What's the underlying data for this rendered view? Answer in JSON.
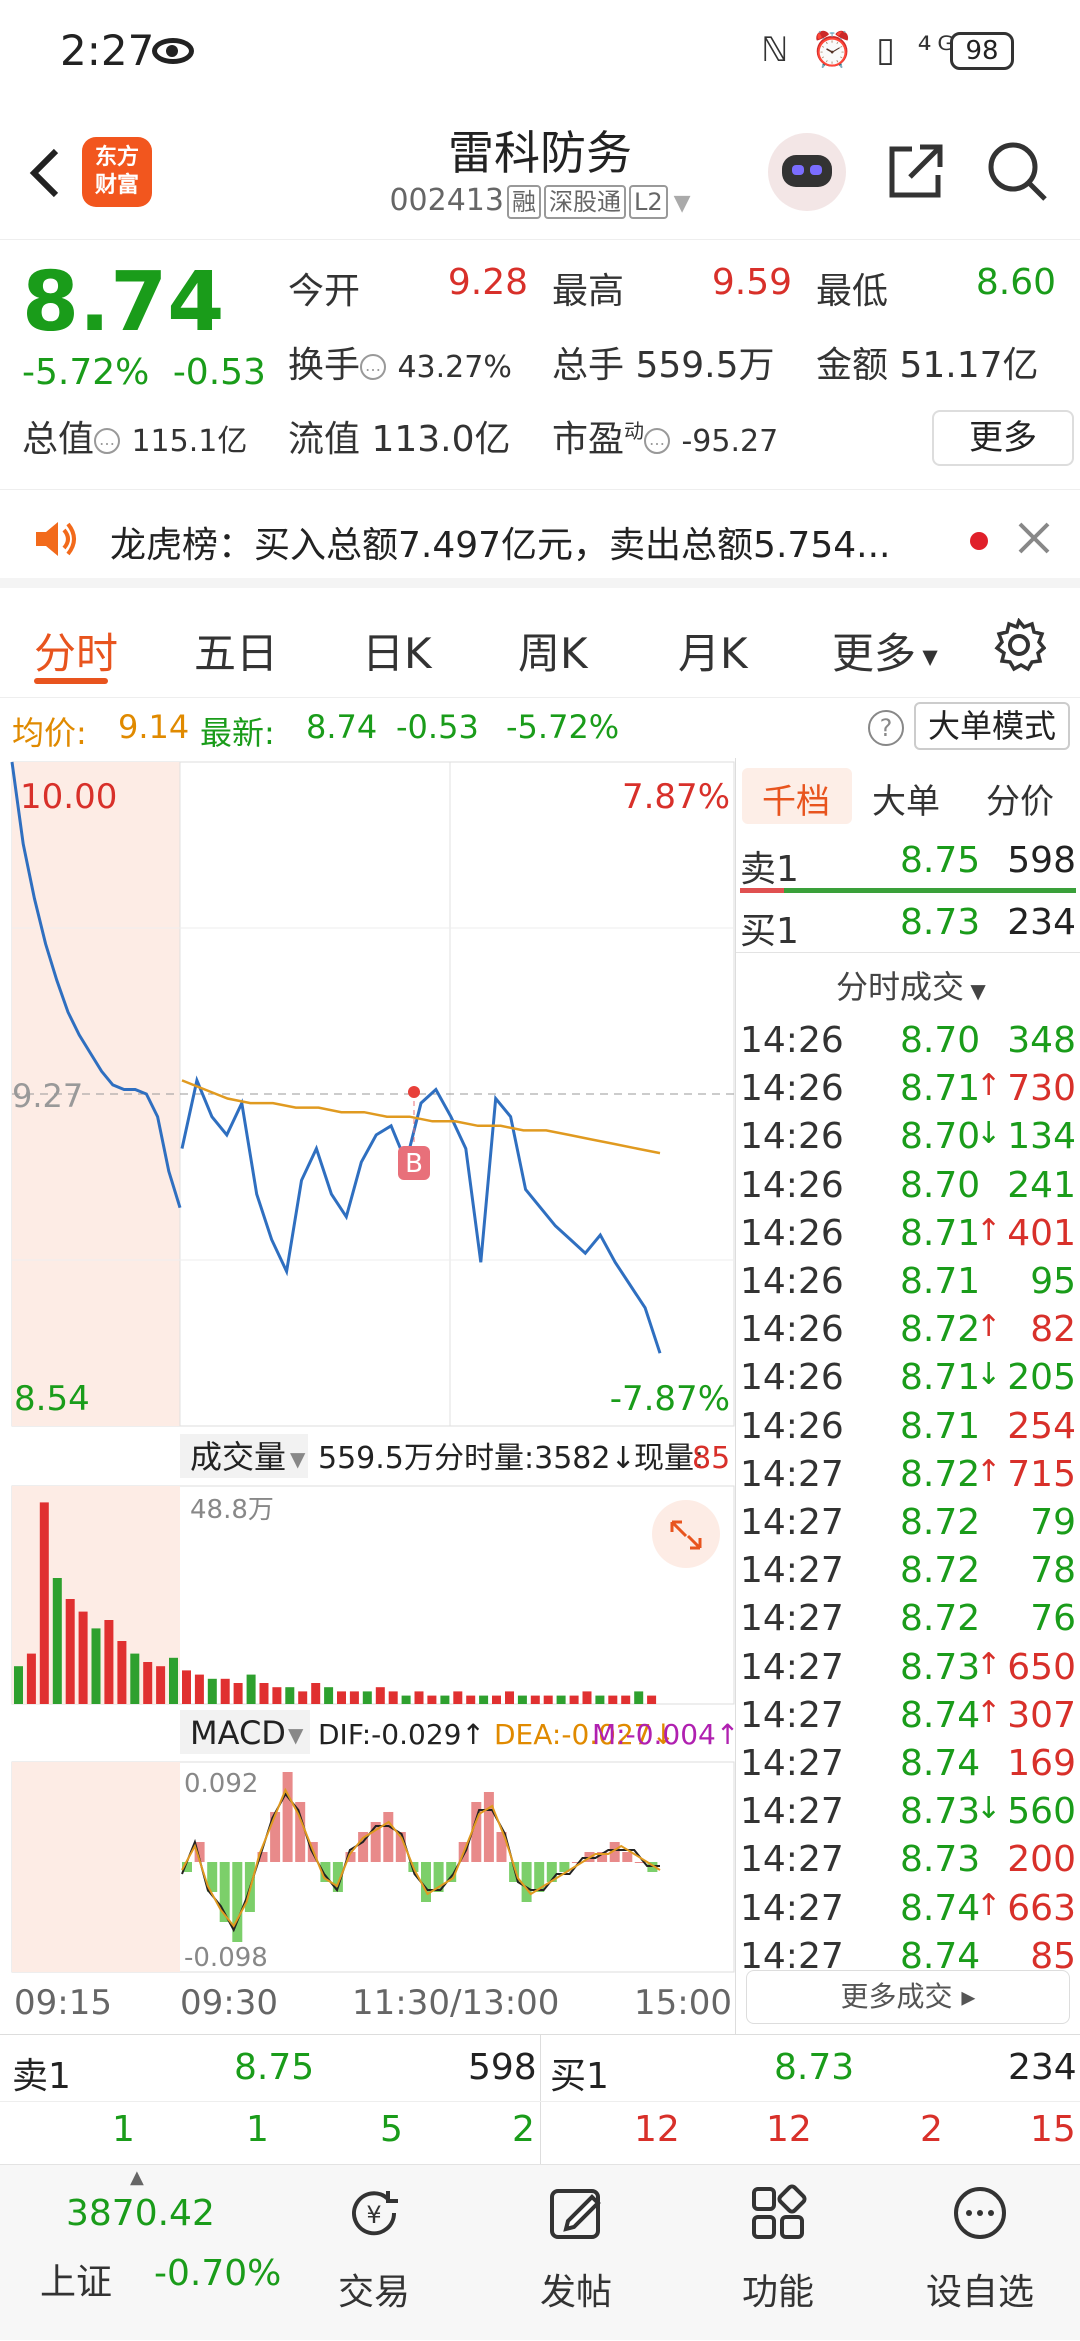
{
  "status_bar": {
    "time": "2:27",
    "battery": "98",
    "icons": "ℕ ⏰ ▯ ⁴ᴳ"
  },
  "header": {
    "back_icon": "chevron-left-icon",
    "logo_text": "东方财富",
    "stock_name": "雷科防务",
    "stock_code": "002413",
    "tags": [
      "融",
      "深股通",
      "L2"
    ]
  },
  "quote": {
    "price": "8.74",
    "change_pct": "-5.72%",
    "change": "-0.53",
    "open_label": "今开",
    "open": "9.28",
    "high_label": "最高",
    "high": "9.59",
    "low_label": "最低",
    "low": "8.60",
    "turnover_label": "换手",
    "turnover": "43.27%",
    "volume_label": "总手",
    "volume": "559.5万",
    "amount_label": "金额",
    "amount": "51.17亿",
    "mcap_label": "总值",
    "mcap": "115.1亿",
    "float_label": "流值",
    "float_cap": "113.0亿",
    "pe_label": "市盈",
    "pe_sup": "动",
    "pe": "-95.27",
    "more_label": "更多",
    "colors": {
      "up": "#d8302a",
      "down": "#1a9c1a",
      "accent": "#e8541e"
    }
  },
  "notice": {
    "text": "龙虎榜：买入总额7.497亿元，卖出总额5.754..."
  },
  "tabs": [
    "分时",
    "五日",
    "日K",
    "周K",
    "月K",
    "更多"
  ],
  "avg_bar": {
    "avg_label": "均价:",
    "avg": "9.14",
    "latest_label": "最新:",
    "latest": "8.74",
    "chg": "-0.53",
    "pct": "-5.72%",
    "mode_label": "大单模式",
    "help": "?"
  },
  "chart_data": [
    {
      "type": "line",
      "title": "",
      "y_top_label": "10.00",
      "y_mid_label": "9.27",
      "y_bottom_label": "8.54",
      "pct_top": "7.87%",
      "pct_bottom": "-7.87%",
      "x_ticks": [
        "09:15",
        "09:30",
        "11:30/13:00",
        "15:00"
      ],
      "marker": "B",
      "ylim": [
        8.54,
        10.0
      ],
      "series": [
        {
          "name": "price",
          "values": [
            10.0,
            9.82,
            9.7,
            9.6,
            9.52,
            9.45,
            9.4,
            9.36,
            9.32,
            9.29,
            9.28,
            9.28,
            9.27,
            9.22,
            9.1,
            9.02,
            9.15,
            9.3,
            9.22,
            9.18,
            9.25,
            9.05,
            8.95,
            8.88,
            9.08,
            9.15,
            9.05,
            9.0,
            9.12,
            9.18,
            9.2,
            9.12,
            9.25,
            9.28,
            9.22,
            9.15,
            8.9,
            9.26,
            9.22,
            9.06,
            9.02,
            8.98,
            8.95,
            8.92,
            8.96,
            8.9,
            8.85,
            8.8,
            8.7
          ]
        },
        {
          "name": "avg",
          "values": [
            9.3,
            9.28,
            9.26,
            9.25,
            9.25,
            9.24,
            9.24,
            9.23,
            9.23,
            9.22,
            9.22,
            9.21,
            9.21,
            9.2,
            9.2,
            9.19,
            9.19,
            9.18,
            9.17,
            9.16,
            9.15,
            9.14
          ]
        }
      ]
    },
    {
      "type": "bar",
      "title": "成交量",
      "total": "559.5万",
      "tick_label": "分时量:3582↓",
      "now_label": "现量:",
      "now": "85",
      "max_label": "48.8万",
      "values": [
        9,
        12,
        48,
        30,
        25,
        22,
        18,
        20,
        15,
        12,
        10,
        9,
        11,
        8,
        7,
        6,
        6,
        5,
        7,
        5,
        4,
        4,
        3,
        5,
        4,
        3,
        3,
        3,
        4,
        3,
        2,
        3,
        2,
        2,
        3,
        2,
        2,
        2,
        3,
        2,
        2,
        2,
        2,
        2,
        3,
        2,
        2,
        2,
        3,
        2
      ]
    },
    {
      "type": "bar",
      "title": "MACD",
      "dif": "DIF:-0.029↑",
      "dea": "DEA:-0.027↓",
      "m": "M:-0.004↑",
      "max_label": "0.092",
      "min_label": "-0.098",
      "values": [
        -0.01,
        0.02,
        -0.03,
        -0.06,
        -0.08,
        -0.05,
        0.01,
        0.05,
        0.09,
        0.06,
        0.02,
        -0.02,
        -0.03,
        0.01,
        0.03,
        0.04,
        0.05,
        0.03,
        -0.01,
        -0.04,
        -0.03,
        -0.02,
        0.02,
        0.06,
        0.07,
        0.03,
        -0.02,
        -0.04,
        -0.03,
        -0.02,
        -0.01,
        0.0,
        0.01,
        0.01,
        0.02,
        0.01,
        0.0,
        -0.01
      ]
    }
  ],
  "right_panel": {
    "tabs": [
      "千档",
      "大单",
      "分价"
    ],
    "ask": {
      "label": "卖1",
      "price": "8.75",
      "vol": "598"
    },
    "bid": {
      "label": "买1",
      "price": "8.73",
      "vol": "234"
    },
    "ticks_title": "分时成交",
    "ticks": [
      {
        "t": "14:26",
        "p": "8.70",
        "a": "",
        "v": "348",
        "c": "g"
      },
      {
        "t": "14:26",
        "p": "8.71",
        "a": "↑",
        "v": "730",
        "c": "r"
      },
      {
        "t": "14:26",
        "p": "8.70",
        "a": "↓",
        "v": "134",
        "c": "g"
      },
      {
        "t": "14:26",
        "p": "8.70",
        "a": "",
        "v": "241",
        "c": "g"
      },
      {
        "t": "14:26",
        "p": "8.71",
        "a": "↑",
        "v": "401",
        "c": "r"
      },
      {
        "t": "14:26",
        "p": "8.71",
        "a": "",
        "v": "95",
        "c": "g"
      },
      {
        "t": "14:26",
        "p": "8.72",
        "a": "↑",
        "v": "82",
        "c": "r"
      },
      {
        "t": "14:26",
        "p": "8.71",
        "a": "↓",
        "v": "205",
        "c": "g"
      },
      {
        "t": "14:26",
        "p": "8.71",
        "a": "",
        "v": "254",
        "c": "r"
      },
      {
        "t": "14:27",
        "p": "8.72",
        "a": "↑",
        "v": "715",
        "c": "r"
      },
      {
        "t": "14:27",
        "p": "8.72",
        "a": "",
        "v": "79",
        "c": "g"
      },
      {
        "t": "14:27",
        "p": "8.72",
        "a": "",
        "v": "78",
        "c": "g"
      },
      {
        "t": "14:27",
        "p": "8.72",
        "a": "",
        "v": "76",
        "c": "g"
      },
      {
        "t": "14:27",
        "p": "8.73",
        "a": "↑",
        "v": "650",
        "c": "r"
      },
      {
        "t": "14:27",
        "p": "8.74",
        "a": "↑",
        "v": "307",
        "c": "r"
      },
      {
        "t": "14:27",
        "p": "8.74",
        "a": "",
        "v": "169",
        "c": "r"
      },
      {
        "t": "14:27",
        "p": "8.73",
        "a": "↓",
        "v": "560",
        "c": "g"
      },
      {
        "t": "14:27",
        "p": "8.73",
        "a": "",
        "v": "200",
        "c": "r"
      },
      {
        "t": "14:27",
        "p": "8.74",
        "a": "↑",
        "v": "663",
        "c": "r"
      },
      {
        "t": "14:27",
        "p": "8.74",
        "a": "",
        "v": "85",
        "c": "r"
      }
    ],
    "more_ticks": "更多成交 ▸"
  },
  "bottom_order": {
    "ask_label": "卖1",
    "ask_price": "8.75",
    "ask_vol": "598",
    "bid_label": "买1",
    "bid_price": "8.73",
    "bid_vol": "234",
    "ask_counts": [
      "1",
      "1",
      "5",
      "2"
    ],
    "bid_counts": [
      "12",
      "12",
      "2",
      "15"
    ]
  },
  "navbar": {
    "index_value": "3870.42",
    "index_name": "上证",
    "index_pct": "-0.70%",
    "items": [
      "交易",
      "发帖",
      "功能",
      "设自选"
    ]
  }
}
